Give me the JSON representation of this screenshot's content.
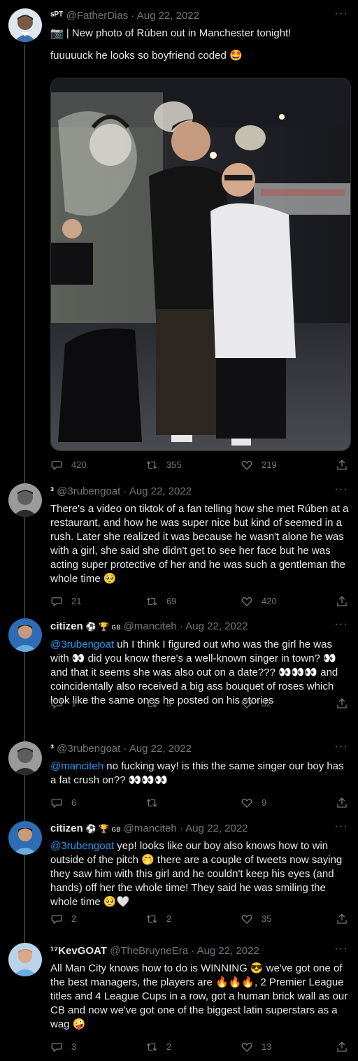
{
  "colors": {
    "background": "#000000",
    "text": "#e7e9ea",
    "muted": "#71767b",
    "link": "#1d9bf0",
    "border": "#2f3336"
  },
  "tweets": [
    {
      "display_name": "ˢᴾᵀ",
      "handle": "@FatherDias",
      "date": "Aug 22, 2022",
      "lines": [
        "📷 | New photo of Rúben out in Manchester tonight!",
        "",
        "fuuuuuck he looks so boyfriend coded 🤩"
      ],
      "media_alt": "Photo of two men posing in a restaurant",
      "replies": "420",
      "retweets": "355",
      "likes": "219"
    },
    {
      "display_name": "³",
      "handle": "@3rubengoat",
      "date": "Aug 22, 2022",
      "text": "There's a video on tiktok of a fan telling how she met Rúben at a restaurant, and how he was super nice but kind of seemed in a rush. Later she realized it was because he wasn't alone he was with a girl, she said she didn't get to see her face but he was acting super protective of her and he was such a gentleman the whole time 🥺",
      "replies": "21",
      "retweets": "69",
      "likes": "420"
    },
    {
      "display_name": "citizen",
      "badges": "⚽ 🏆 ɢʙ",
      "handle": "@manciteh",
      "date": "Aug 22, 2022",
      "mention": "@3rubengoat",
      "text": " uh I think I figured out who was the girl he was with 👀 did you know there's a well-known singer in town? 👀 and that it seems she was also out on a date??? 👀👀👀 and coincidentally also received a big ass bouquet of roses which look like the same ones he posted on his stories",
      "replies": "1",
      "retweets": "3",
      "likes": "32"
    },
    {
      "display_name": "³",
      "handle": "@3rubengoat",
      "date": "Aug 22, 2022",
      "mention": "@manciteh",
      "text": " no fucking way! is this the same singer our boy has a fat crush on?? 👀👀👀",
      "replies": "6",
      "retweets": "",
      "likes": "9"
    },
    {
      "display_name": "citizen",
      "badges": "⚽ 🏆 ɢʙ",
      "handle": "@manciteh",
      "date": "Aug 22, 2022",
      "mention": "@3rubengoat",
      "text": " yep! looks like our boy also knows how to win outside of the pitch 🤭 there are a couple of tweets now saying they saw him with this girl and he couldn't keep his eyes (and hands) off her the whole time! They said he was smiling the whole time 🥺🤍",
      "replies": "2",
      "retweets": "2",
      "likes": "35"
    },
    {
      "display_name": "¹⁷KevGOAT",
      "handle": "@TheBruyneEra",
      "date": "Aug 22, 2022",
      "text": "All Man City knows how to do is WINNING 😎 we've got one of the best managers, the players are 🔥🔥🔥, 2 Premier League titles and 4 League Cups in a row, got a human brick wall as our CB and now we've got one of the biggest latin superstars as a wag 🤪",
      "replies": "3",
      "retweets": "2",
      "likes": "13"
    }
  ],
  "ui": {
    "more_glyph": "···",
    "dot": "·"
  }
}
